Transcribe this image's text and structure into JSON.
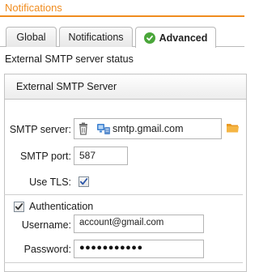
{
  "header": {
    "title": "Notifications"
  },
  "tabs": [
    {
      "label": "Global"
    },
    {
      "label": "Notifications"
    },
    {
      "label": "Advanced"
    }
  ],
  "status_title": "External SMTP server status",
  "panel": {
    "title": "External SMTP Server"
  },
  "form": {
    "smtp_server_label": "SMTP server:",
    "smtp_server_value": "smtp.gmail.com",
    "smtp_port_label": "SMTP port:",
    "smtp_port_value": "587",
    "use_tls_label": "Use TLS:",
    "use_tls_checked": true,
    "authentication_label": "Authentication",
    "authentication_checked": true,
    "username_label": "Username:",
    "username_value": "account@gmail.com",
    "password_label": "Password:",
    "password_value": "●●●●●●●●●●●"
  },
  "colors": {
    "accent": "#f08c1e",
    "success": "#4aa63a",
    "tls_check": "#2a55a8"
  }
}
